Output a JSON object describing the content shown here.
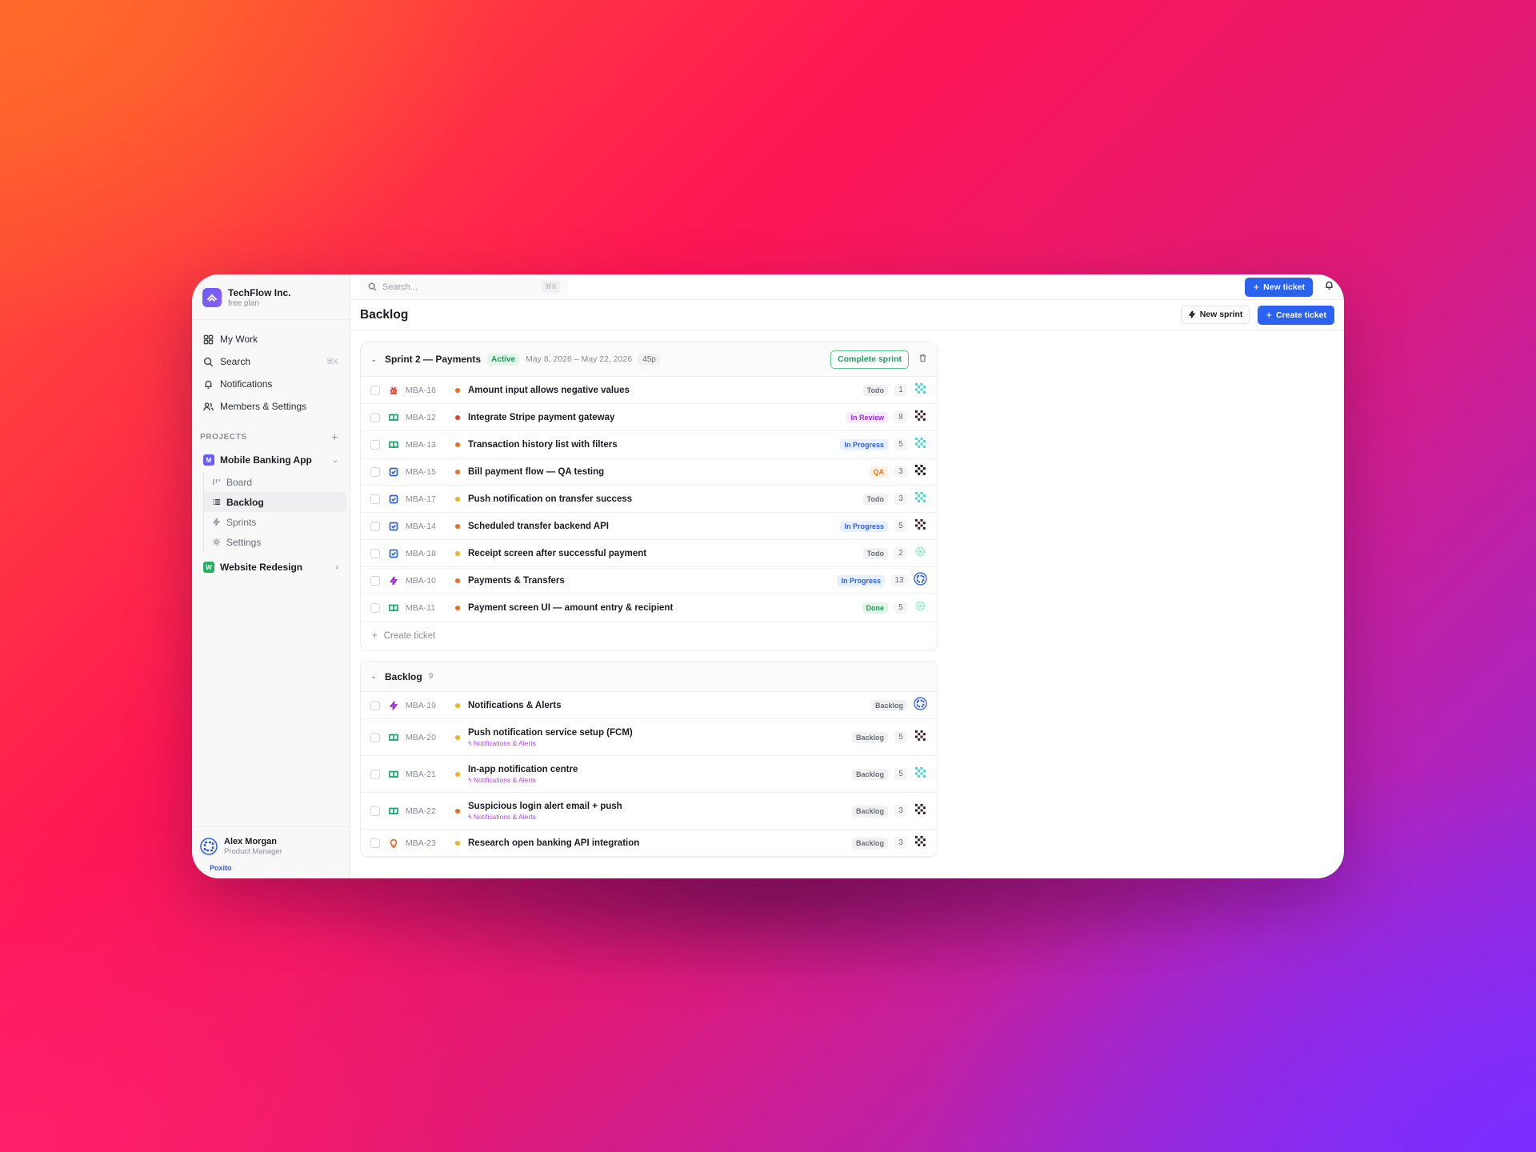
{
  "org": {
    "name": "TechFlow Inc.",
    "plan": "free plan"
  },
  "nav": [
    {
      "label": "My Work",
      "icon": "grid-icon"
    },
    {
      "label": "Search",
      "icon": "search-icon",
      "kbd": "⌘K"
    },
    {
      "label": "Notifications",
      "icon": "bell-icon"
    },
    {
      "label": "Members & Settings",
      "icon": "users-icon"
    }
  ],
  "projects_label": "PROJECTS",
  "projects": [
    {
      "badge": "M",
      "name": "Mobile Banking App",
      "color": "#6a5cf6"
    },
    {
      "badge": "W",
      "name": "Website Redesign",
      "color": "#22b45e"
    }
  ],
  "subnav": [
    "Board",
    "Backlog",
    "Sprints",
    "Settings"
  ],
  "user": {
    "name": "Alex Morgan",
    "role": "Product Manager",
    "brand": "Poxito"
  },
  "topbar": {
    "search_placeholder": "Search...",
    "search_kbd": "⌘K",
    "new_ticket": "New ticket"
  },
  "page": {
    "title": "Backlog",
    "new_sprint": "New sprint",
    "create_ticket": "Create ticket"
  },
  "sprint": {
    "title": "Sprint 2 — Payments",
    "status": "Active",
    "dates": "May 8, 2026 – May 22, 2026",
    "points": "45p",
    "complete": "Complete sprint",
    "create_label": "Create ticket",
    "rows": [
      {
        "type": "bug",
        "key": "MBA-16",
        "priority": "#f06a1c",
        "title": "Amount input allows negative values",
        "status": "Todo",
        "st": "todo",
        "est": "1",
        "av": "teal"
      },
      {
        "type": "story",
        "key": "MBA-12",
        "priority": "#e5402a",
        "title": "Integrate Stripe payment gateway",
        "status": "In Review",
        "st": "review",
        "est": "8",
        "av": "dark"
      },
      {
        "type": "story",
        "key": "MBA-13",
        "priority": "#f06a1c",
        "title": "Transaction history list with filters",
        "status": "In Progress",
        "st": "progress",
        "est": "5",
        "av": "teal"
      },
      {
        "type": "task",
        "key": "MBA-15",
        "priority": "#f06a1c",
        "title": "Bill payment flow — QA testing",
        "status": "QA",
        "st": "qa",
        "est": "3",
        "av": "black"
      },
      {
        "type": "task",
        "key": "MBA-17",
        "priority": "#f0b020",
        "title": "Push notification on transfer success",
        "status": "Todo",
        "st": "todo",
        "est": "3",
        "av": "teal"
      },
      {
        "type": "task",
        "key": "MBA-14",
        "priority": "#f06a1c",
        "title": "Scheduled transfer backend API",
        "status": "In Progress",
        "st": "progress",
        "est": "5",
        "av": "dark"
      },
      {
        "type": "task",
        "key": "MBA-18",
        "priority": "#f0b020",
        "title": "Receipt screen after successful payment",
        "status": "Todo",
        "st": "todo",
        "est": "2",
        "av": "mint"
      },
      {
        "type": "epic",
        "key": "MBA-10",
        "priority": "#f06a1c",
        "title": "Payments & Transfers",
        "status": "In Progress",
        "st": "progress",
        "est": "13",
        "av": "blue"
      },
      {
        "type": "story",
        "key": "MBA-11",
        "priority": "#f06a1c",
        "title": "Payment screen UI — amount entry & recipient",
        "status": "Done",
        "st": "done",
        "est": "5",
        "av": "mint"
      }
    ]
  },
  "backlog": {
    "title": "Backlog",
    "count": "9",
    "rows": [
      {
        "type": "epic",
        "key": "MBA-19",
        "priority": "#f0b020",
        "title": "Notifications & Alerts",
        "epic": "",
        "status": "Backlog",
        "est": "",
        "av": "blue"
      },
      {
        "type": "story",
        "key": "MBA-20",
        "priority": "#f0b020",
        "title": "Push notification service setup (FCM)",
        "epic": "Notifications & Alerts",
        "status": "Backlog",
        "est": "5",
        "av": "dark"
      },
      {
        "type": "story",
        "key": "MBA-21",
        "priority": "#f0b020",
        "title": "In-app notification centre",
        "epic": "Notifications & Alerts",
        "status": "Backlog",
        "est": "5",
        "av": "teal"
      },
      {
        "type": "story",
        "key": "MBA-22",
        "priority": "#f06a1c",
        "title": "Suspicious login alert email + push",
        "epic": "Notifications & Alerts",
        "status": "Backlog",
        "est": "3",
        "av": "dark"
      },
      {
        "type": "idea",
        "key": "MBA-23",
        "priority": "#f0b020",
        "title": "Research open banking API integration",
        "epic": "",
        "status": "Backlog",
        "est": "3",
        "av": "dark"
      }
    ]
  }
}
